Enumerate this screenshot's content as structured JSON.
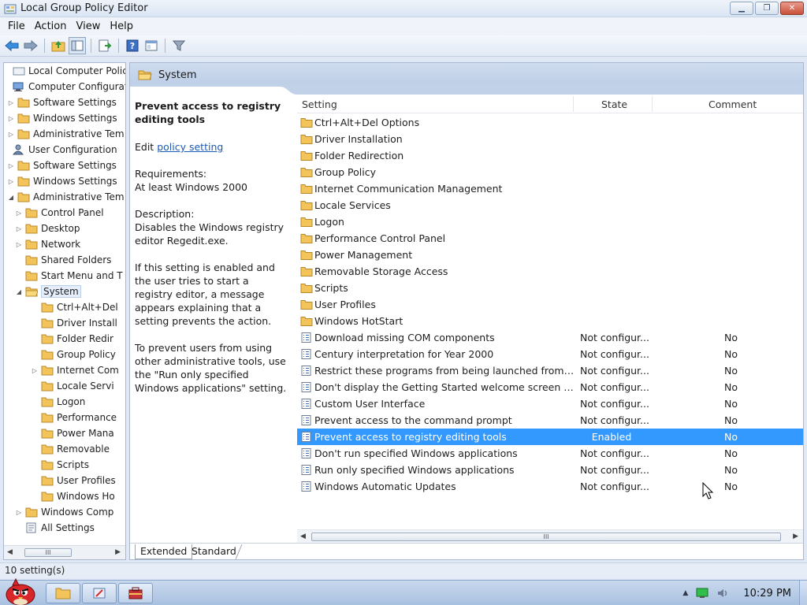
{
  "window": {
    "title": "Local Group Policy Editor",
    "minimize_glyph": "▁",
    "restore_glyph": "❐",
    "close_glyph": "✕"
  },
  "menu": [
    "File",
    "Action",
    "View",
    "Help"
  ],
  "tree": {
    "nodes": [
      {
        "label": "Local Computer Policy",
        "level": 0,
        "icon": "computer-icon",
        "expander": ""
      },
      {
        "label": "Computer Configuratio",
        "level": 0,
        "icon": "computer-config-icon",
        "expander": ""
      },
      {
        "label": "Software Settings",
        "level": 1,
        "icon": "folder-icon",
        "expander": "▷"
      },
      {
        "label": "Windows Settings",
        "level": 1,
        "icon": "folder-icon",
        "expander": "▷"
      },
      {
        "label": "Administrative Tem",
        "level": 1,
        "icon": "folder-icon",
        "expander": "▷"
      },
      {
        "label": "User Configuration",
        "level": 0,
        "icon": "user-config-icon",
        "expander": ""
      },
      {
        "label": "Software Settings",
        "level": 1,
        "icon": "folder-icon",
        "expander": "▷"
      },
      {
        "label": "Windows Settings",
        "level": 1,
        "icon": "folder-icon",
        "expander": "▷"
      },
      {
        "label": "Administrative Tem",
        "level": 1,
        "icon": "folder-icon",
        "expander": "◢"
      },
      {
        "label": "Control Panel",
        "level": 2,
        "icon": "folder-icon",
        "expander": "▷"
      },
      {
        "label": "Desktop",
        "level": 2,
        "icon": "folder-icon",
        "expander": "▷"
      },
      {
        "label": "Network",
        "level": 2,
        "icon": "folder-icon",
        "expander": "▷"
      },
      {
        "label": "Shared Folders",
        "level": 2,
        "icon": "folder-icon",
        "expander": ""
      },
      {
        "label": "Start Menu and T",
        "level": 2,
        "icon": "folder-icon",
        "expander": ""
      },
      {
        "label": "System",
        "level": 2,
        "icon": "folder-open-icon",
        "expander": "◢",
        "selected": true
      },
      {
        "label": "Ctrl+Alt+Del",
        "level": 3,
        "icon": "folder-icon",
        "expander": ""
      },
      {
        "label": "Driver Install",
        "level": 3,
        "icon": "folder-icon",
        "expander": ""
      },
      {
        "label": "Folder Redir",
        "level": 3,
        "icon": "folder-icon",
        "expander": ""
      },
      {
        "label": "Group Policy",
        "level": 3,
        "icon": "folder-icon",
        "expander": ""
      },
      {
        "label": "Internet Com",
        "level": 3,
        "icon": "folder-icon",
        "expander": "▷"
      },
      {
        "label": "Locale Servi",
        "level": 3,
        "icon": "folder-icon",
        "expander": ""
      },
      {
        "label": "Logon",
        "level": 3,
        "icon": "folder-icon",
        "expander": ""
      },
      {
        "label": "Performance",
        "level": 3,
        "icon": "folder-icon",
        "expander": ""
      },
      {
        "label": "Power Mana",
        "level": 3,
        "icon": "folder-icon",
        "expander": ""
      },
      {
        "label": "Removable",
        "level": 3,
        "icon": "folder-icon",
        "expander": ""
      },
      {
        "label": "Scripts",
        "level": 3,
        "icon": "folder-icon",
        "expander": ""
      },
      {
        "label": "User Profiles",
        "level": 3,
        "icon": "folder-icon",
        "expander": ""
      },
      {
        "label": "Windows Ho",
        "level": 3,
        "icon": "folder-icon",
        "expander": ""
      },
      {
        "label": "Windows Comp",
        "level": 2,
        "icon": "folder-icon",
        "expander": "▷"
      },
      {
        "label": "All Settings",
        "level": 2,
        "icon": "all-settings-icon",
        "expander": ""
      }
    ],
    "scroll_left": "◀",
    "scroll_right": "▶",
    "scroll_thumb": "III"
  },
  "right_header": {
    "title": "System"
  },
  "description": {
    "title": "Prevent access to registry editing tools",
    "edit_prefix": "Edit",
    "edit_link": "policy setting",
    "requirements_label": "Requirements:",
    "requirements_value": "At least Windows 2000",
    "description_label": "Description:",
    "description_text": "Disables the Windows registry editor Regedit.exe.",
    "para2": "If this setting is enabled and the user tries to start a registry editor, a message appears explaining that a setting prevents the action.",
    "para3": "To prevent users from using other administrative tools, use the \"Run only specified Windows applications\" setting."
  },
  "list": {
    "columns": {
      "setting": "Setting",
      "state": "State",
      "comment": "Comment"
    },
    "rows": [
      {
        "name": "Ctrl+Alt+Del Options",
        "state": "",
        "comment": "",
        "type": "folder"
      },
      {
        "name": "Driver Installation",
        "state": "",
        "comment": "",
        "type": "folder"
      },
      {
        "name": "Folder Redirection",
        "state": "",
        "comment": "",
        "type": "folder"
      },
      {
        "name": "Group Policy",
        "state": "",
        "comment": "",
        "type": "folder"
      },
      {
        "name": "Internet Communication Management",
        "state": "",
        "comment": "",
        "type": "folder"
      },
      {
        "name": "Locale Services",
        "state": "",
        "comment": "",
        "type": "folder"
      },
      {
        "name": "Logon",
        "state": "",
        "comment": "",
        "type": "folder"
      },
      {
        "name": "Performance Control Panel",
        "state": "",
        "comment": "",
        "type": "folder"
      },
      {
        "name": "Power Management",
        "state": "",
        "comment": "",
        "type": "folder"
      },
      {
        "name": "Removable Storage Access",
        "state": "",
        "comment": "",
        "type": "folder"
      },
      {
        "name": "Scripts",
        "state": "",
        "comment": "",
        "type": "folder"
      },
      {
        "name": "User Profiles",
        "state": "",
        "comment": "",
        "type": "folder"
      },
      {
        "name": "Windows HotStart",
        "state": "",
        "comment": "",
        "type": "folder"
      },
      {
        "name": "Download missing COM components",
        "state": "Not configur...",
        "comment": "No",
        "type": "policy"
      },
      {
        "name": "Century interpretation for Year 2000",
        "state": "Not configur...",
        "comment": "No",
        "type": "policy"
      },
      {
        "name": "Restrict these programs from being launched from He...",
        "state": "Not configur...",
        "comment": "No",
        "type": "policy"
      },
      {
        "name": "Don't display the Getting Started welcome screen at lo...",
        "state": "Not configur...",
        "comment": "No",
        "type": "policy"
      },
      {
        "name": "Custom User Interface",
        "state": "Not configur...",
        "comment": "No",
        "type": "policy"
      },
      {
        "name": "Prevent access to the command prompt",
        "state": "Not configur...",
        "comment": "No",
        "type": "policy"
      },
      {
        "name": "Prevent access to registry editing tools",
        "state": "Enabled",
        "comment": "No",
        "type": "policy",
        "selected": true
      },
      {
        "name": "Don't run specified Windows applications",
        "state": "Not configur...",
        "comment": "No",
        "type": "policy"
      },
      {
        "name": "Run only specified Windows applications",
        "state": "Not configur...",
        "comment": "No",
        "type": "policy"
      },
      {
        "name": "Windows Automatic Updates",
        "state": "Not configur...",
        "comment": "No",
        "type": "policy"
      }
    ],
    "scroll_left": "◀",
    "scroll_right": "▶",
    "scroll_thumb": "III"
  },
  "tabs": [
    "Extended",
    "Standard"
  ],
  "status": {
    "text": "10 setting(s)"
  },
  "taskbar": {
    "clock": "10:29 PM",
    "tray_arrow": "▲"
  },
  "colors": {
    "selection": "#3399ff",
    "link": "#1a5ab8",
    "folder": "#f2c45a"
  }
}
